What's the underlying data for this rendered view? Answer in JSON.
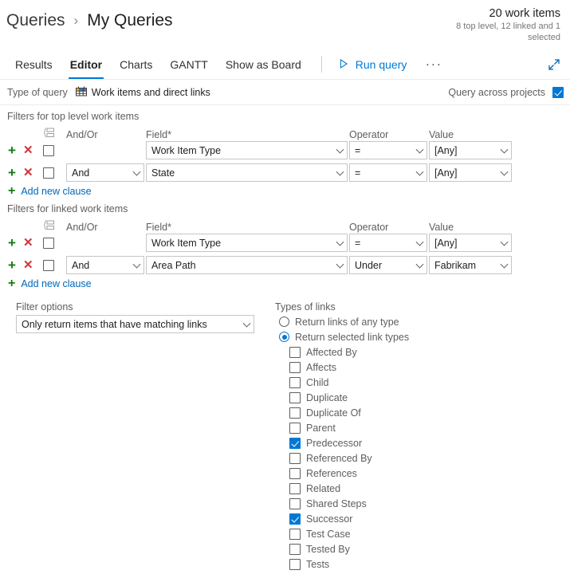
{
  "header": {
    "breadcrumb_root": "Queries",
    "breadcrumb_sep": "›",
    "breadcrumb_leaf": "My Queries",
    "count_main": "20 work items",
    "count_sub": "8 top level, 12 linked and 1 selected"
  },
  "tabs": [
    {
      "label": "Results",
      "active": false
    },
    {
      "label": "Editor",
      "active": true
    },
    {
      "label": "Charts",
      "active": false
    },
    {
      "label": "GANTT",
      "active": false
    },
    {
      "label": "Show as Board",
      "active": false
    }
  ],
  "commands": {
    "run_query": "Run query",
    "more": "···"
  },
  "query_type": {
    "label": "Type of query",
    "value": "Work items and direct links",
    "across_label": "Query across projects",
    "across_checked": true
  },
  "top_level": {
    "section_title": "Filters for top level work items",
    "headers": {
      "andor": "And/Or",
      "field": "Field*",
      "operator": "Operator",
      "value": "Value"
    },
    "rows": [
      {
        "andor": "",
        "field": "Work Item Type",
        "operator": "=",
        "value": "[Any]",
        "checked": false
      },
      {
        "andor": "And",
        "field": "State",
        "operator": "=",
        "value": "[Any]",
        "checked": false
      }
    ],
    "add_clause": "Add new clause"
  },
  "linked": {
    "section_title": "Filters for linked work items",
    "headers": {
      "andor": "And/Or",
      "field": "Field*",
      "operator": "Operator",
      "value": "Value"
    },
    "rows": [
      {
        "andor": "",
        "field": "Work Item Type",
        "operator": "=",
        "value": "[Any]",
        "checked": false
      },
      {
        "andor": "And",
        "field": "Area Path",
        "operator": "Under",
        "value": "Fabrikam",
        "checked": false
      }
    ],
    "add_clause": "Add new clause"
  },
  "filter_options": {
    "label": "Filter options",
    "value": "Only return items that have matching links"
  },
  "types_of_links": {
    "title": "Types of links",
    "radios": [
      {
        "label": "Return links of any type",
        "selected": false
      },
      {
        "label": "Return selected link types",
        "selected": true
      }
    ],
    "link_types": [
      {
        "label": "Affected By",
        "checked": false
      },
      {
        "label": "Affects",
        "checked": false
      },
      {
        "label": "Child",
        "checked": false
      },
      {
        "label": "Duplicate",
        "checked": false
      },
      {
        "label": "Duplicate Of",
        "checked": false
      },
      {
        "label": "Parent",
        "checked": false
      },
      {
        "label": "Predecessor",
        "checked": true
      },
      {
        "label": "Referenced By",
        "checked": false
      },
      {
        "label": "References",
        "checked": false
      },
      {
        "label": "Related",
        "checked": false
      },
      {
        "label": "Shared Steps",
        "checked": false
      },
      {
        "label": "Successor",
        "checked": true
      },
      {
        "label": "Test Case",
        "checked": false
      },
      {
        "label": "Tested By",
        "checked": false
      },
      {
        "label": "Tests",
        "checked": false
      }
    ]
  },
  "colors": {
    "accent": "#0078d4",
    "link": "#0067b8",
    "add_green": "#107c10",
    "delete_red": "#d13438",
    "muted_text": "#605e5c"
  }
}
